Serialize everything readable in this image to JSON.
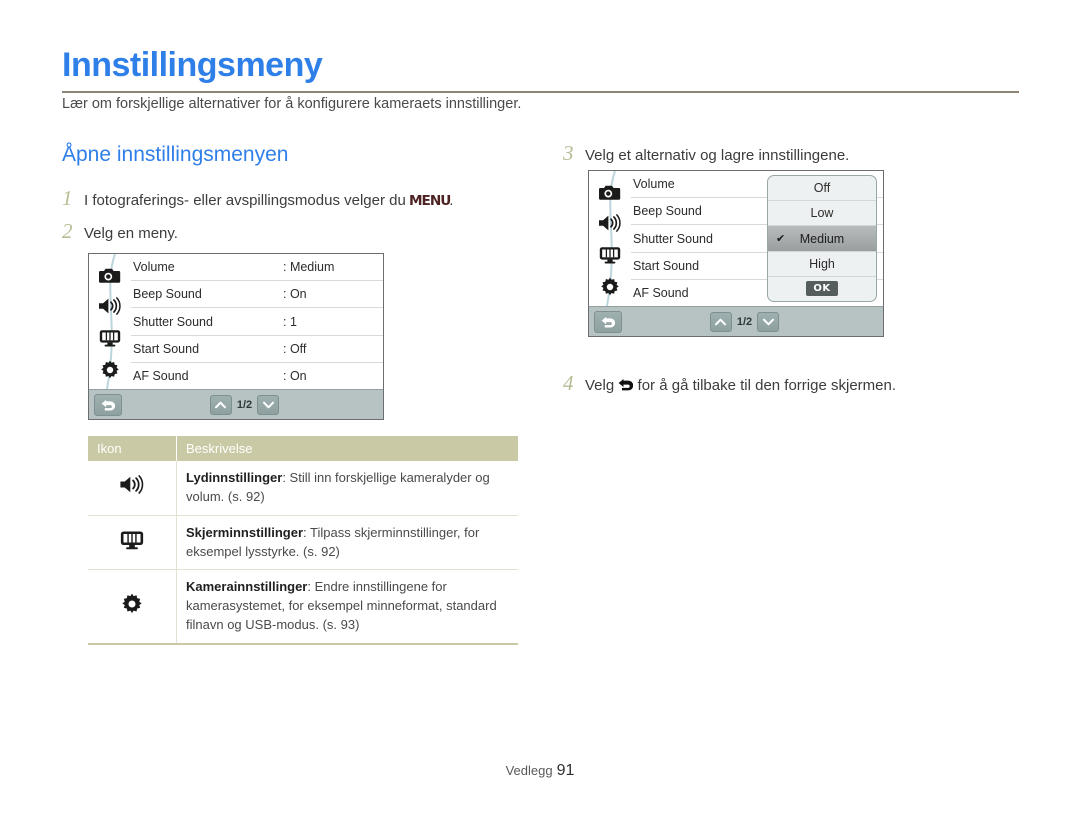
{
  "document": {
    "title": "Innstillingsmeny",
    "subtitle": "Lær om forskjellige alternativer for å konfigurere kameraets innstillinger.",
    "section_heading": "Åpne innstillingsmenyen",
    "footer_label": "Vedlegg",
    "footer_page": "91",
    "accent_color": "#2f7fe8",
    "rule_color": "#8d8378",
    "step_number_color": "#b9bd94",
    "table_header_color": "#c9c9a5"
  },
  "steps": {
    "one": {
      "number": "1",
      "text_before": "I fotograferings- eller avspillingsmodus velger du ",
      "menu_glyph": "MENU",
      "text_after": "."
    },
    "two": {
      "number": "2",
      "text": "Velg en meny."
    },
    "three": {
      "number": "3",
      "text": "Velg et alternativ og lagre innstillingene."
    },
    "four": {
      "number": "4",
      "text_before": "Velg ",
      "back_glyph": "↰",
      "text_after": " for å gå tilbake til den forrige skjermen."
    }
  },
  "lcd_left": {
    "rail_icons": [
      "camera-icon",
      "speaker-icon",
      "display-icon",
      "gear-icon"
    ],
    "rows": [
      {
        "label": "Volume",
        "value": ": Medium"
      },
      {
        "label": "Beep Sound",
        "value": ": On"
      },
      {
        "label": "Shutter Sound",
        "value": ": 1"
      },
      {
        "label": "Start Sound",
        "value": ": Off"
      },
      {
        "label": "AF Sound",
        "value": ": On"
      }
    ],
    "bar": {
      "back": "↰",
      "up": "⌃",
      "page": "1/2",
      "down": "⌄"
    }
  },
  "lcd_right": {
    "rail_icons": [
      "camera-icon",
      "speaker-icon",
      "display-icon",
      "gear-icon"
    ],
    "rows": [
      {
        "label": "Volume"
      },
      {
        "label": "Beep Sound"
      },
      {
        "label": "Shutter Sound"
      },
      {
        "label": "Start Sound"
      },
      {
        "label": "AF Sound"
      }
    ],
    "dropdown": {
      "options": [
        {
          "label": "Off",
          "selected": false
        },
        {
          "label": "Low",
          "selected": false
        },
        {
          "label": "Medium",
          "selected": true
        },
        {
          "label": "High",
          "selected": false
        }
      ],
      "check_glyph": "✔",
      "ok_label": "OK"
    },
    "bar": {
      "back": "↰",
      "up": "⌃",
      "page": "1/2",
      "down": "⌄"
    }
  },
  "desc_table": {
    "headers": {
      "icon": "Ikon",
      "description": "Beskrivelse"
    },
    "rows": [
      {
        "icon": "speaker-icon",
        "term": "Lydinnstillinger",
        "text": ": Still inn forskjellige kameralyder og volum. (s. 92)"
      },
      {
        "icon": "display-icon",
        "term": "Skjerminnstillinger",
        "text": ": Tilpass skjerminnstillinger, for eksempel lysstyrke. (s. 92)"
      },
      {
        "icon": "gear-icon",
        "term": "Kamerainnstillinger",
        "text": ": Endre innstillingene for kamerasystemet, for eksempel minneformat, standard filnavn og USB-modus. (s. 93)"
      }
    ]
  }
}
